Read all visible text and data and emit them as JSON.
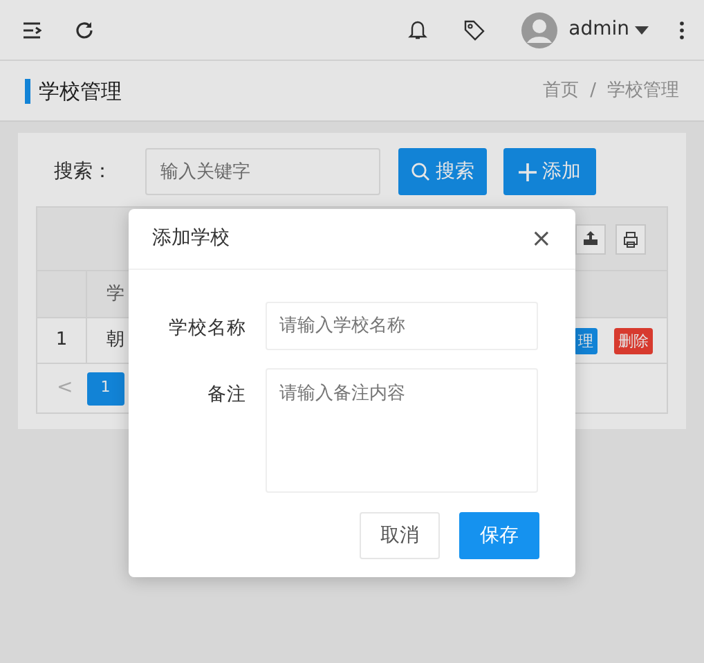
{
  "topbar": {
    "user": "admin"
  },
  "page_header": {
    "title": "学校管理",
    "breadcrumb": [
      {
        "label": "首页"
      },
      {
        "label": "学校管理"
      }
    ],
    "separator": "/"
  },
  "search": {
    "label": "搜索：",
    "placeholder": "输入关键字"
  },
  "buttons": [
    {
      "label": "搜索",
      "kind": "search"
    },
    {
      "label": "添加",
      "kind": "add"
    }
  ],
  "table": {
    "columns": [
      "",
      "学"
    ],
    "rows": [
      {
        "cells": [
          "1",
          "朝"
        ],
        "actions": [
          {
            "label": "理",
            "kind": "primary"
          },
          {
            "label": "删除",
            "kind": "danger"
          }
        ]
      }
    ],
    "pagination": {
      "prev": "<",
      "pages": [
        {
          "label": "1",
          "selected": true
        }
      ]
    }
  },
  "modal": {
    "title": "添加学校",
    "close": "×",
    "fields": [
      {
        "label": "学校名称",
        "placeholder": "请输入学校名称",
        "kind": "input"
      },
      {
        "label": "备注",
        "placeholder": "请输入备注内容",
        "kind": "textarea"
      }
    ],
    "buttons": [
      {
        "label": "取消",
        "kind": "default"
      },
      {
        "label": "保存",
        "kind": "primary"
      }
    ]
  }
}
